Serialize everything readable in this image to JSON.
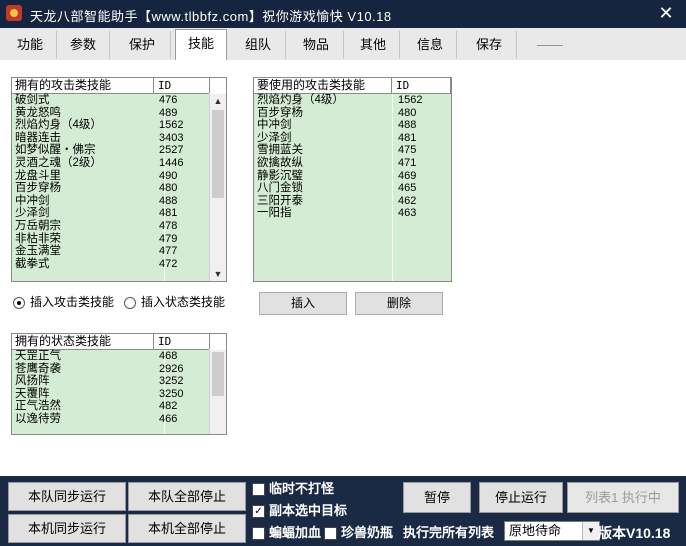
{
  "window": {
    "title": "天龙八部智能助手【www.tlbbfz.com】祝你游戏愉快  V10.18",
    "close_glyph": "✕"
  },
  "tabs": [
    {
      "label": "功能"
    },
    {
      "label": "参数"
    },
    {
      "label": "保护"
    },
    {
      "label": "技能",
      "active": true
    },
    {
      "label": "组队"
    },
    {
      "label": "物品"
    },
    {
      "label": "其他"
    },
    {
      "label": "信息"
    },
    {
      "label": "保存"
    },
    {
      "label": "——"
    }
  ],
  "owned_attack": {
    "col_name": "拥有的攻击类技能",
    "col_id": "ID",
    "rows": [
      {
        "name": "破剑式",
        "id": "476"
      },
      {
        "name": "黄龙怒鸣",
        "id": "489"
      },
      {
        "name": "烈焰灼身（4级）",
        "id": "1562"
      },
      {
        "name": "暗器连击",
        "id": "3403"
      },
      {
        "name": "如梦似醒・佛宗",
        "id": "2527"
      },
      {
        "name": "灵酒之魂（2级）",
        "id": "1446"
      },
      {
        "name": "龙盘斗里",
        "id": "490"
      },
      {
        "name": "百步穿杨",
        "id": "480"
      },
      {
        "name": "中冲剑",
        "id": "488"
      },
      {
        "name": "少泽剑",
        "id": "481"
      },
      {
        "name": "万岳朝宗",
        "id": "478"
      },
      {
        "name": "非枯非荣",
        "id": "479"
      },
      {
        "name": "金玉满堂",
        "id": "477"
      },
      {
        "name": "截拳式",
        "id": "472"
      }
    ]
  },
  "use_attack": {
    "col_name": "要使用的攻击类技能",
    "col_id": "ID",
    "rows": [
      {
        "name": "烈焰灼身（4级）",
        "id": "1562"
      },
      {
        "name": "百步穿杨",
        "id": "480"
      },
      {
        "name": "中冲剑",
        "id": "488"
      },
      {
        "name": "少泽剑",
        "id": "481"
      },
      {
        "name": "雪拥蓝关",
        "id": "475"
      },
      {
        "name": "欲擒故纵",
        "id": "471"
      },
      {
        "name": "静影沉璧",
        "id": "469"
      },
      {
        "name": "八门金锁",
        "id": "465"
      },
      {
        "name": "三阳开泰",
        "id": "462"
      },
      {
        "name": "一阳指",
        "id": "463"
      }
    ]
  },
  "radios": {
    "attack": "插入攻击类技能",
    "status": "插入状态类技能",
    "selected": "attack"
  },
  "actions": {
    "insert": "插入",
    "delete": "删除"
  },
  "owned_status": {
    "col_name": "拥有的状态类技能",
    "col_id": "ID",
    "rows": [
      {
        "name": "天罡正气",
        "id": "468"
      },
      {
        "name": "苍鹰奇袭",
        "id": "2926"
      },
      {
        "name": "风扬阵",
        "id": "3252"
      },
      {
        "name": "天覆阵",
        "id": "3250"
      },
      {
        "name": "正气浩然",
        "id": "482"
      },
      {
        "name": "以逸待劳",
        "id": "466"
      }
    ]
  },
  "bottom": {
    "team_sync_run": "本队同步运行",
    "team_all_stop": "本队全部停止",
    "local_sync_run": "本机同步运行",
    "local_all_stop": "本机全部停止",
    "temp_no_fight": "临时不打怪",
    "instance_select_target": "副本选中目标",
    "bat_heal": "蝙蝠加血",
    "pet_milk": "珍兽奶瓶",
    "pause": "暂停",
    "stop_run": "停止运行",
    "list_running": "列表1 执行中",
    "after_all_lists": "执行完所有列表",
    "after_select_value": "原地待命",
    "version": "版本V10.18"
  },
  "state": {
    "temp_no_fight_checked": false,
    "instance_select_target_checked": true,
    "bat_heal_checked": false,
    "pet_milk_checked": false
  },
  "colors": {
    "title_bg": "#16253f",
    "bottom_bg": "#1a2a44",
    "list_id_bg": "#d4ecd3"
  }
}
